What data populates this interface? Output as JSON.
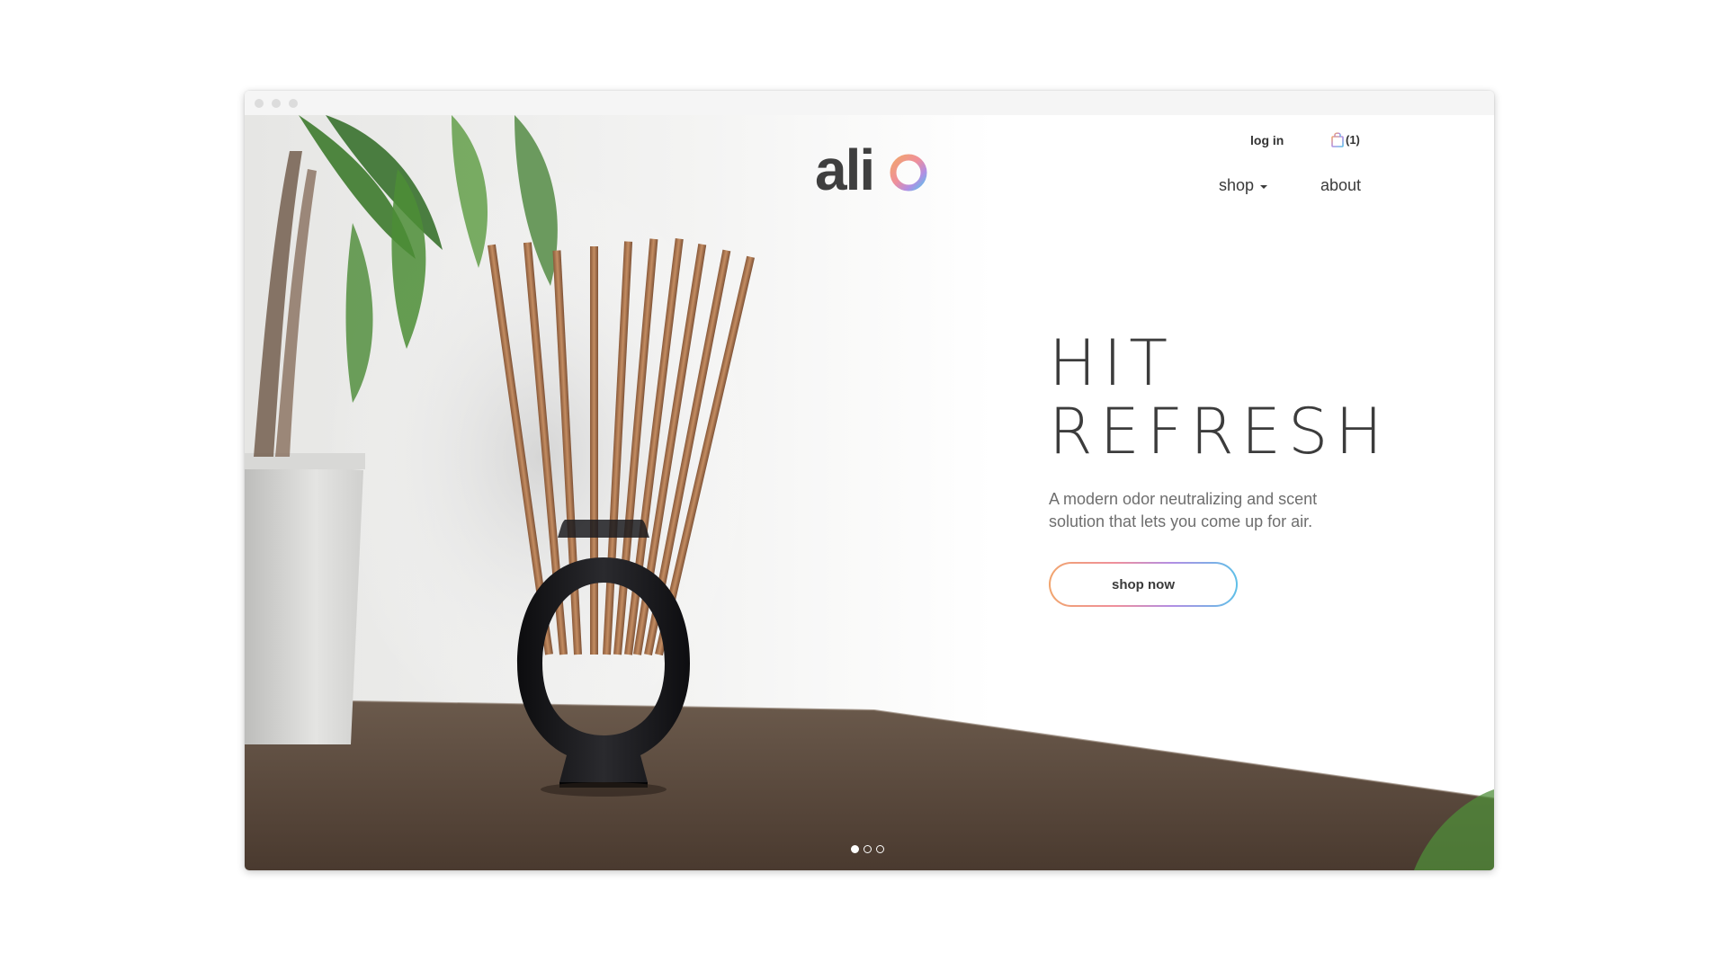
{
  "brand": {
    "logo_text": "alio",
    "logo_color": "#3f3f3f",
    "gradient": [
      "#f1a56e",
      "#ef8f9b",
      "#b28ee3",
      "#5fc0e8"
    ]
  },
  "header": {
    "login_label": "log in",
    "cart_icon": "shopping-bag-icon",
    "cart_count": "(1)"
  },
  "nav": {
    "items": [
      {
        "label": "shop",
        "has_dropdown": true
      },
      {
        "label": "about",
        "has_dropdown": false
      }
    ]
  },
  "hero": {
    "headline_line1": "HIT",
    "headline_line2": "REFRESH",
    "subtext": "A modern odor neutralizing and scent solution that lets you come up for air.",
    "cta_label": "shop now"
  },
  "carousel": {
    "slide_count": 3,
    "active_index": 0
  }
}
